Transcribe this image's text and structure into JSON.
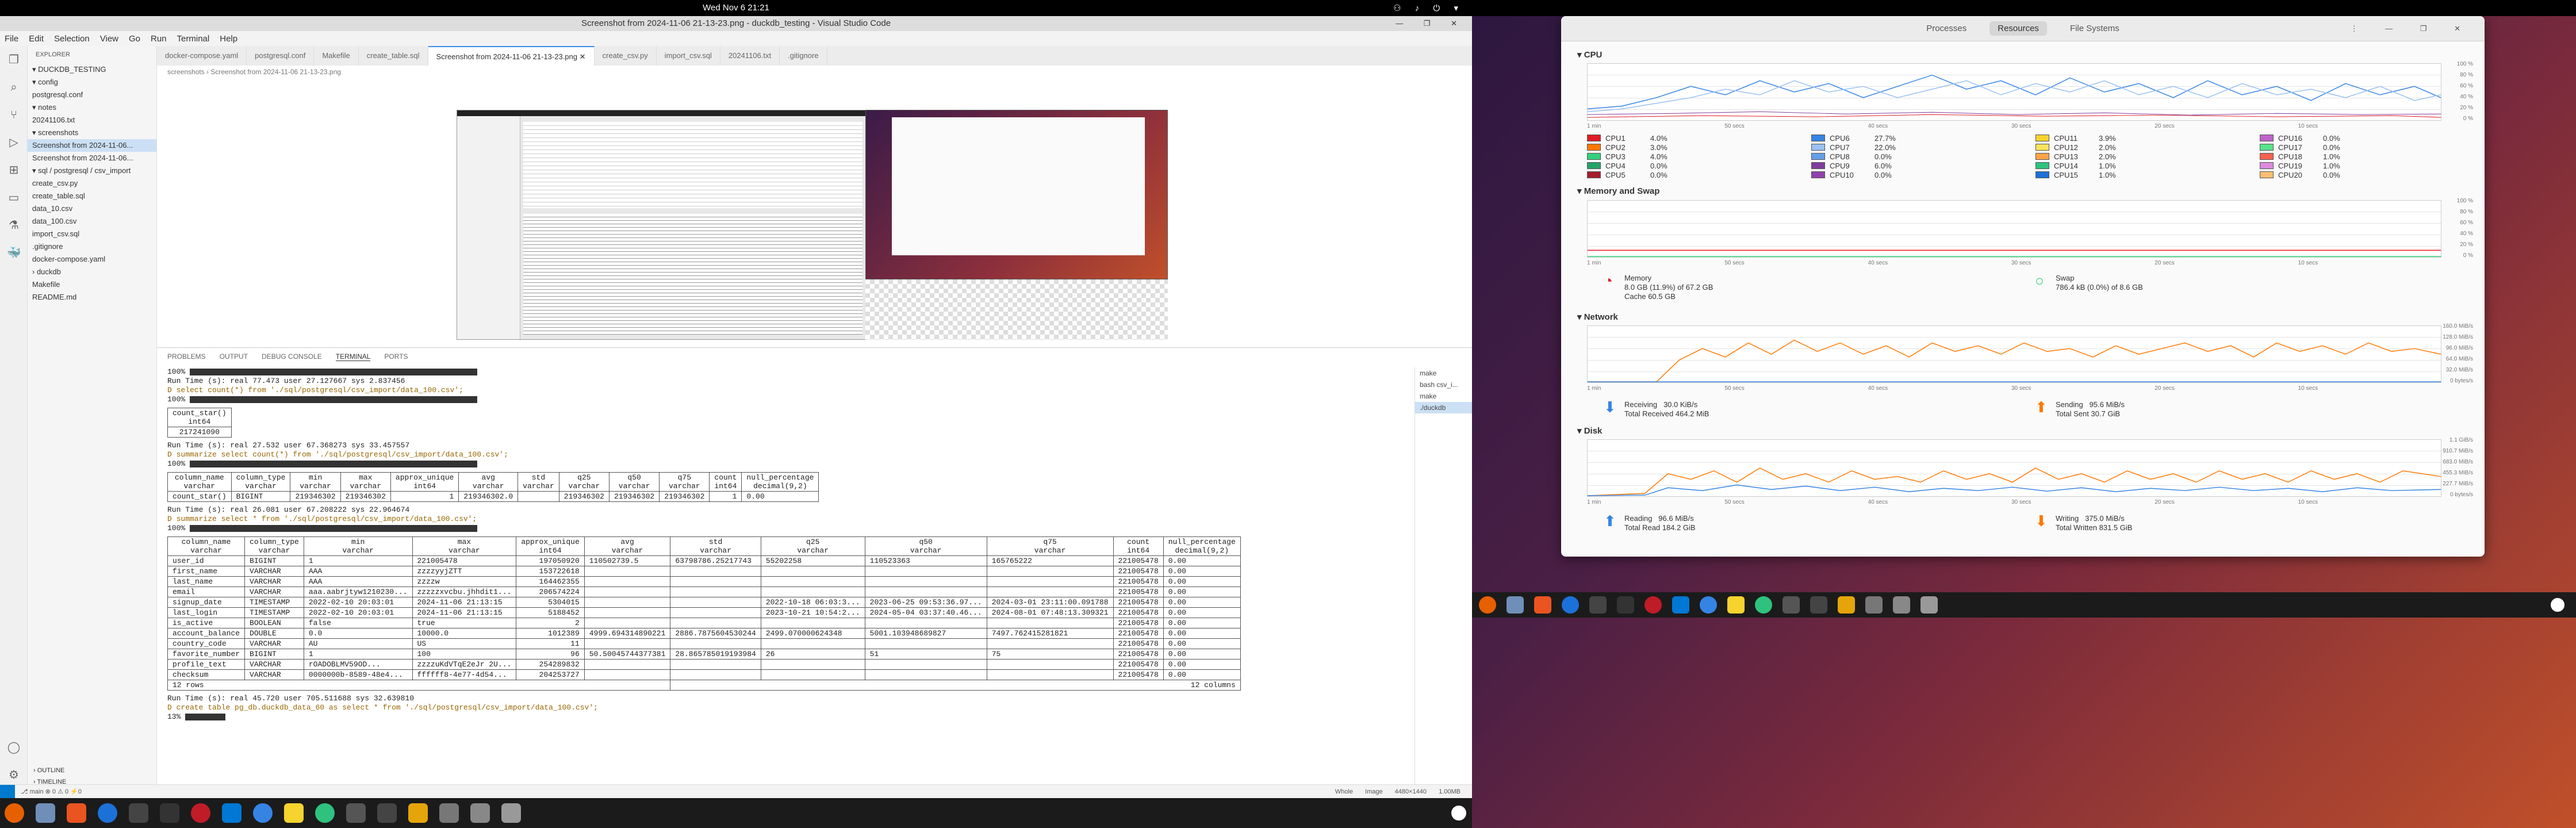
{
  "topbar": {
    "clock": "Wed Nov 6  21:21",
    "tray": "⚇ ♪ ⏻ ▾"
  },
  "vscode": {
    "title": "Screenshot from 2024-11-06 21-13-23.png - duckdb_testing - Visual Studio Code",
    "window_controls": "— ❐ ✕",
    "menus": [
      "File",
      "Edit",
      "Selection",
      "View",
      "Go",
      "Run",
      "Terminal",
      "Help"
    ],
    "explorer_header": "EXPLORER",
    "tree": [
      "▾ DUCKDB_TESTING",
      "  ▾ config",
      "      postgresql.conf",
      "  ▾ notes",
      "      20241106.txt",
      "  ▾ screenshots",
      "      Screenshot from 2024-11-06...",
      "      Screenshot from 2024-11-06...",
      "  ▾ sql / postgresql / csv_import",
      "      create_csv.py",
      "      create_table.sql",
      "      data_10.csv",
      "      data_100.csv",
      "      import_csv.sql",
      "    .gitignore",
      "    docker-compose.yaml",
      "  › duckdb",
      "    Makefile",
      "    README.md"
    ],
    "outline": "› OUTLINE",
    "timeline": "› TIMELINE",
    "tabs": [
      "docker-compose.yaml",
      "postgresql.conf",
      "Makefile",
      "create_table.sql",
      "Screenshot from 2024-11-06 21-13-23.png ✕",
      "create_csv.py",
      "import_csv.sql",
      "20241106.txt",
      ".gitignore"
    ],
    "breadcrumb": "screenshots › Screenshot from 2024-11-06 21-13-23.png",
    "panel_tabs": [
      "PROBLEMS",
      "OUTPUT",
      "DEBUG CONSOLE",
      "TERMINAL",
      "PORTS"
    ],
    "term_list": [
      "make",
      "bash csv_i...",
      "make",
      "./duckdb"
    ],
    "status_left": "⎇ main  ⊗ 0 ⚠ 0   ⚡0",
    "status_right": "Whole Image  4480×1440  1.00MB"
  },
  "terminal": {
    "l1": "100% ",
    "l2": "Run Time (s): real 77.473 user 27.127667 sys 2.837456",
    "l3": "D select count(*) from './sql/postgresql/csv_import/data_100.csv';",
    "l4": "100% ",
    "count_header": [
      "count_star()",
      "int64"
    ],
    "count_value": "217241090",
    "l5": "Run Time (s): real 27.532 user 67.368273 sys 33.457557",
    "l6": "D summarize select count(*) from './sql/postgresql/csv_import/data_100.csv';",
    "l7": "100% ",
    "summ1_headers": [
      [
        "column_name",
        "varchar"
      ],
      [
        "column_type",
        "varchar"
      ],
      [
        "min",
        "varchar"
      ],
      [
        "max",
        "varchar"
      ],
      [
        "approx_unique",
        "int64"
      ],
      [
        "avg",
        "varchar"
      ],
      [
        "std",
        "varchar"
      ],
      [
        "q25",
        "varchar"
      ],
      [
        "q50",
        "varchar"
      ],
      [
        "q75",
        "varchar"
      ],
      [
        "count",
        "int64"
      ],
      [
        "null_percentage",
        "decimal(9,2)"
      ]
    ],
    "summ1_row": [
      "count_star()",
      "BIGINT",
      "219346302",
      "219346302",
      "1",
      "219346302.0",
      "",
      "219346302",
      "219346302",
      "219346302",
      "1",
      "0.00"
    ],
    "l8": "Run Time (s): real 26.081 user 67.208222 sys 22.964674",
    "l9": "D summarize select * from './sql/postgresql/csv_import/data_100.csv';",
    "l10": "100% ",
    "summ2_headers": [
      [
        "column_name",
        "varchar"
      ],
      [
        "column_type",
        "varchar"
      ],
      [
        "min",
        "varchar"
      ],
      [
        "max",
        "varchar"
      ],
      [
        "approx_unique",
        "int64"
      ],
      [
        "avg",
        "varchar"
      ],
      [
        "std",
        "varchar"
      ],
      [
        "q25",
        "varchar"
      ],
      [
        "q50",
        "varchar"
      ],
      [
        "q75",
        "varchar"
      ],
      [
        "count",
        "int64"
      ],
      [
        "null_percentage",
        "decimal(9,2)"
      ]
    ],
    "summ2_rows": [
      [
        "user_id",
        "BIGINT",
        "1",
        "221005478",
        "197050920",
        "110502739.5",
        "63798786.25217743",
        "55202258",
        "110523363",
        "165765222",
        "221005478",
        "0.00"
      ],
      [
        "first_name",
        "VARCHAR",
        "AAA",
        "zzzzyyjZTT",
        "153722618",
        "",
        "",
        "",
        "",
        "",
        "221005478",
        "0.00"
      ],
      [
        "last_name",
        "VARCHAR",
        "AAA",
        "zzzzw",
        "164462355",
        "",
        "",
        "",
        "",
        "",
        "221005478",
        "0.00"
      ],
      [
        "email",
        "VARCHAR",
        "aaa.aabrjtyw1210230...",
        "zzzzzxvcbu.jhhdit1...",
        "206574224",
        "",
        "",
        "",
        "",
        "",
        "221005478",
        "0.00"
      ],
      [
        "signup_date",
        "TIMESTAMP",
        "2022-02-10 20:03:01",
        "2024-11-06 21:13:15",
        "5304015",
        "",
        "",
        "2022-10-18 06:03:3...",
        "2023-06-25 09:53:36.97...",
        "2024-03-01 23:11:00.091788",
        "221005478",
        "0.00"
      ],
      [
        "last_login",
        "TIMESTAMP",
        "2022-02-10 20:03:01",
        "2024-11-06 21:13:15",
        "5188452",
        "",
        "",
        "2023-10-21 10:54:2...",
        "2024-05-04 03:37:40.46...",
        "2024-08-01 07:48:13.309321",
        "221005478",
        "0.00"
      ],
      [
        "is_active",
        "BOOLEAN",
        "false",
        "true",
        "2",
        "",
        "",
        "",
        "",
        "",
        "221005478",
        "0.00"
      ],
      [
        "account_balance",
        "DOUBLE",
        "0.0",
        "10000.0",
        "1012389",
        "4999.694314890221",
        "2886.7875604530244",
        "2499.070000624348",
        "5001.103948689827",
        "7497.762415281821",
        "221005478",
        "0.00"
      ],
      [
        "country_code",
        "VARCHAR",
        "AU",
        "US",
        "11",
        "",
        "",
        "",
        "",
        "",
        "221005478",
        "0.00"
      ],
      [
        "favorite_number",
        "BIGINT",
        "1",
        "100",
        "96",
        "50.50045744377381",
        "28.865785019193984",
        "26",
        "51",
        "75",
        "221005478",
        "0.00"
      ],
      [
        "profile_text",
        "VARCHAR",
        "rOADOBLMV59OD...",
        "zzzzuKdVTqE2eJr 2U...",
        "254289832",
        "",
        "",
        "",
        "",
        "",
        "221005478",
        "0.00"
      ],
      [
        "checksum",
        "VARCHAR",
        "0000000b-8589-48e4...",
        "ffffff8-4e77-4d54...",
        "204253727",
        "",
        "",
        "",
        "",
        "",
        "221005478",
        "0.00"
      ]
    ],
    "rows_footer_left": "12 rows",
    "rows_footer_right": "12 columns",
    "l11": "Run Time (s): real 45.720 user 705.511688 sys 32.639810",
    "l12": "D create table pg_db.duckdb_data_60 as select * from './sql/postgresql/csv_import/data_100.csv';",
    "l13": "13% "
  },
  "monitor": {
    "tabs": [
      "Processes",
      "Resources",
      "File Systems"
    ],
    "window_controls": "⋮ — ❐ ✕",
    "cpu_title": "CPU",
    "cpu_y": [
      "100 %",
      "80 %",
      "60 %",
      "40 %",
      "20 %",
      "0 %"
    ],
    "x_labels": [
      "1 min",
      "50 secs",
      "40 secs",
      "30 secs",
      "20 secs",
      "10 secs"
    ],
    "cpu_legend": [
      {
        "n": "CPU1",
        "v": "4.0%",
        "c": "#e01b24"
      },
      {
        "n": "CPU6",
        "v": "27.7%",
        "c": "#3584e4"
      },
      {
        "n": "CPU11",
        "v": "3.9%",
        "c": "#f6d32d"
      },
      {
        "n": "CPU16",
        "v": "0.0%",
        "c": "#c061cb"
      },
      {
        "n": "CPU2",
        "v": "3.0%",
        "c": "#ff7800"
      },
      {
        "n": "CPU7",
        "v": "22.0%",
        "c": "#99c1f1"
      },
      {
        "n": "CPU12",
        "v": "2.0%",
        "c": "#f8e45c"
      },
      {
        "n": "CPU17",
        "v": "0.0%",
        "c": "#57e389"
      },
      {
        "n": "CPU3",
        "v": "4.0%",
        "c": "#33d17a"
      },
      {
        "n": "CPU8",
        "v": "0.0%",
        "c": "#62a0ea"
      },
      {
        "n": "CPU13",
        "v": "2.0%",
        "c": "#ffa348"
      },
      {
        "n": "CPU18",
        "v": "1.0%",
        "c": "#f66151"
      },
      {
        "n": "CPU4",
        "v": "0.0%",
        "c": "#26a269"
      },
      {
        "n": "CPU9",
        "v": "6.0%",
        "c": "#813d9c"
      },
      {
        "n": "CPU14",
        "v": "1.0%",
        "c": "#2ec27e"
      },
      {
        "n": "CPU19",
        "v": "1.0%",
        "c": "#dc8add"
      },
      {
        "n": "CPU5",
        "v": "0.0%",
        "c": "#a51d2d"
      },
      {
        "n": "CPU10",
        "v": "0.0%",
        "c": "#9141ac"
      },
      {
        "n": "CPU15",
        "v": "1.0%",
        "c": "#1c71d8"
      },
      {
        "n": "CPU20",
        "v": "0.0%",
        "c": "#ffbe6f"
      }
    ],
    "mem_title": "Memory and Swap",
    "mem_y": [
      "100 %",
      "80 %",
      "60 %",
      "40 %",
      "20 %",
      "0 %"
    ],
    "memory_label": "Memory",
    "memory_used": "8.0 GB (11.9%) of 67.2 GB",
    "memory_cache": "Cache 60.5 GB",
    "swap_label": "Swap",
    "swap_used": "786.4 kB (0.0%) of 8.6 GB",
    "net_title": "Network",
    "net_y": [
      "160.0 MiB/s",
      "128.0 MiB/s",
      "96.0 MiB/s",
      "64.0 MiB/s",
      "32.0 MiB/s",
      "0 bytes/s"
    ],
    "recv_label": "Receiving",
    "recv_rate": "30.0 KiB/s",
    "recv_total": "Total Received  464.2 MiB",
    "send_label": "Sending",
    "send_rate": "95.6 MiB/s",
    "send_total": "Total Sent  30.7 GiB",
    "disk_title": "Disk",
    "disk_y": [
      "1.1 GiB/s",
      "910.7 MiB/s",
      "683.0 MiB/s",
      "455.3 MiB/s",
      "227.7 MiB/s",
      "0 bytes/s"
    ],
    "read_label": "Reading",
    "read_rate": "96.6 MiB/s",
    "read_total": "Total Read  184.2 GiB",
    "write_label": "Writing",
    "write_rate": "375.0 MiB/s",
    "write_total": "Total Written  831.5 GiB"
  }
}
